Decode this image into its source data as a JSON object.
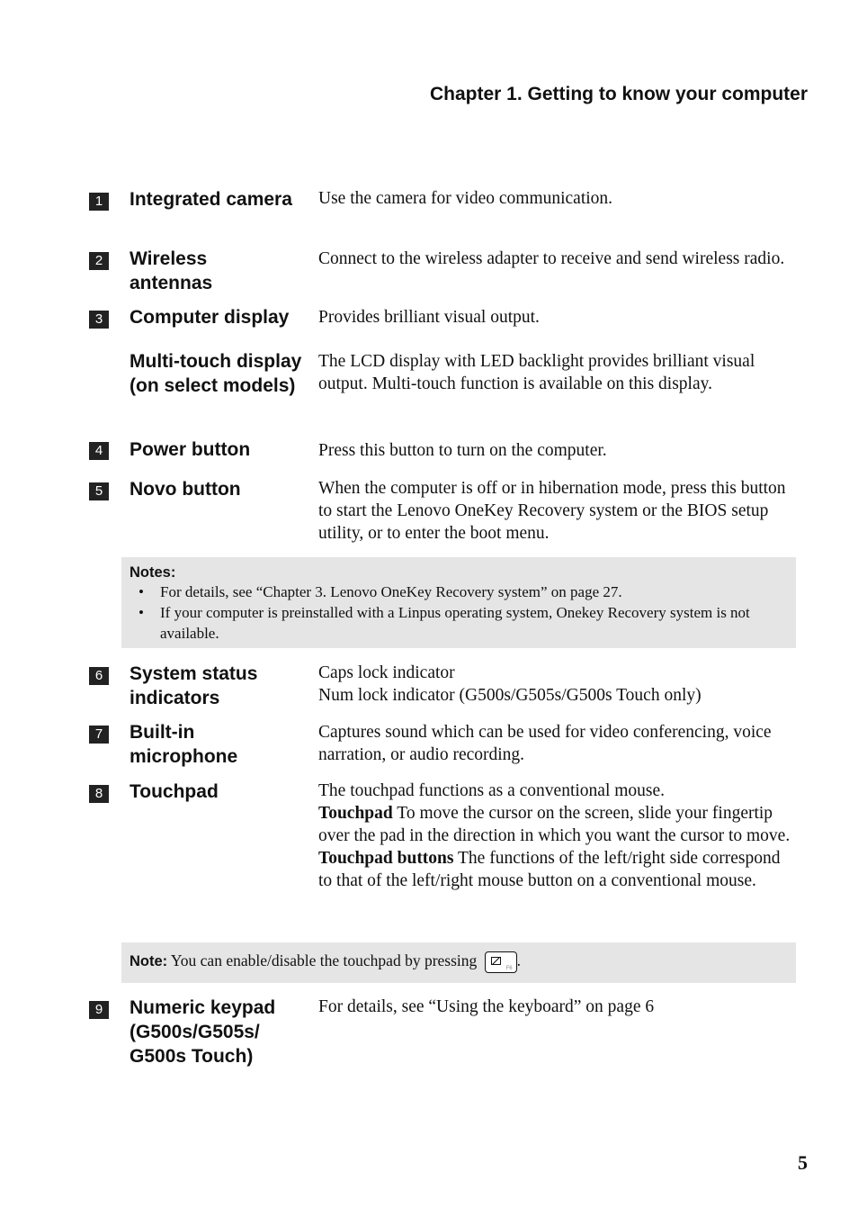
{
  "header": {
    "chapter_title": "Chapter 1. Getting to know your computer"
  },
  "items": [
    {
      "number": "1",
      "term": "Integrated camera",
      "description": "Use the camera for video communication."
    },
    {
      "number": "2",
      "term": "Wireless antennas",
      "description": "Connect to the wireless adapter to receive and send wireless radio."
    },
    {
      "number": "3",
      "term": "Computer display",
      "description": "Provides brilliant visual output."
    },
    {
      "number": "",
      "term": "Multi-touch display (on select models)",
      "description": "The LCD display with LED backlight provides brilliant visual output. Multi-touch function is available on this display."
    },
    {
      "number": "4",
      "term": "Power button",
      "description": "Press this button to turn on the computer."
    },
    {
      "number": "5",
      "term": "Novo button",
      "description": "When the computer is off or in hibernation mode, press this button to start the Lenovo OneKey Recovery system or the BIOS setup utility, or to enter the boot menu."
    },
    {
      "number": "6",
      "term": "System status indicators",
      "description_lines": [
        "Caps lock indicator",
        "Num lock indicator (G500s/G505s/G500s Touch only)"
      ]
    },
    {
      "number": "7",
      "term": "Built-in microphone",
      "description": "Captures sound which can be used for video conferencing, voice narration, or audio recording."
    },
    {
      "number": "8",
      "term": "Touchpad",
      "description_intro": "The touchpad functions as a conventional mouse.",
      "sub1_bold": "Touchpad",
      "sub1_text": " To move the cursor on the screen, slide your fingertip over the pad in the direction in which you want the cursor to move.",
      "sub2_bold": "Touchpad buttons",
      "sub2_text": " The functions of the left/right side correspond to that of the left/right mouse button on a conventional mouse."
    },
    {
      "number": "9",
      "term": "Numeric keypad (G500s/G505s/ G500s Touch)",
      "description": "For details, see “Using the keyboard” on page 6"
    }
  ],
  "notes_box": {
    "title": "Notes:",
    "bullets": [
      "For details, see “Chapter 3. Lenovo OneKey Recovery system” on page 27.",
      "If your computer is preinstalled with a Linpus operating system, Onekey Recovery system is not available."
    ]
  },
  "touchpad_note": {
    "label": "Note:",
    "text": " You can enable/disable the touchpad by pressing",
    "key_icon": "touchpad-toggle-key-icon",
    "key_label": "F6",
    "trailing": "."
  },
  "page_number": "5"
}
